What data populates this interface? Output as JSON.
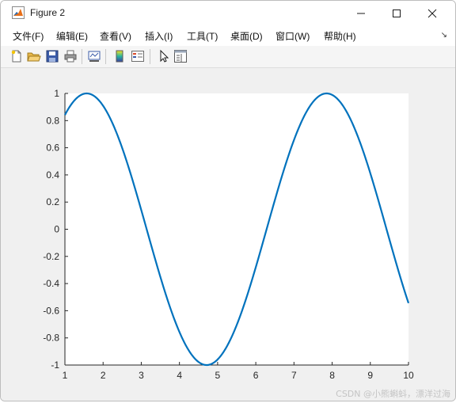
{
  "window": {
    "title": "Figure 2"
  },
  "menu": {
    "items": [
      "文件(F)",
      "编辑(E)",
      "查看(V)",
      "插入(I)",
      "工具(T)",
      "桌面(D)",
      "窗口(W)",
      "帮助(H)"
    ]
  },
  "toolbar": {
    "icons": [
      "new-figure-icon",
      "open-file-icon",
      "save-icon",
      "print-icon",
      "link-plot-icon",
      "colorbar-icon",
      "legend-icon",
      "pointer-icon",
      "property-editor-icon"
    ]
  },
  "chart_data": {
    "type": "line",
    "title": "",
    "xlabel": "",
    "ylabel": "",
    "function": "sin(x)",
    "xlim": [
      1,
      10
    ],
    "ylim": [
      -1,
      1
    ],
    "xticks": [
      1,
      2,
      3,
      4,
      5,
      6,
      7,
      8,
      9,
      10
    ],
    "yticks": [
      1,
      0.8,
      0.6,
      0.4,
      0.2,
      0,
      -0.2,
      -0.4,
      -0.6,
      -0.8,
      -1
    ],
    "ytick_labels": [
      "1",
      "0.8",
      "0.6",
      "0.4",
      "0.2",
      "0",
      "-0.2",
      "-0.4",
      "-0.6",
      "-0.8",
      "-1"
    ],
    "xtick_labels": [
      "1",
      "2",
      "3",
      "4",
      "5",
      "6",
      "7",
      "8",
      "9",
      "10"
    ],
    "series": [
      {
        "color": "#0072BD",
        "x": [
          1,
          1.5,
          2,
          2.5,
          3,
          3.5,
          4,
          4.5,
          5,
          5.5,
          6,
          6.5,
          7,
          7.5,
          8,
          8.5,
          9,
          9.5,
          10
        ],
        "y": [
          0.841,
          0.997,
          0.909,
          0.598,
          0.141,
          -0.351,
          -0.757,
          -0.978,
          -0.959,
          -0.706,
          -0.279,
          0.215,
          0.657,
          0.938,
          0.989,
          0.798,
          0.412,
          -0.075,
          -0.544
        ]
      }
    ],
    "grid": false,
    "box": false
  },
  "watermark": "CSDN @小熊蝌蚪，漂洋过海"
}
